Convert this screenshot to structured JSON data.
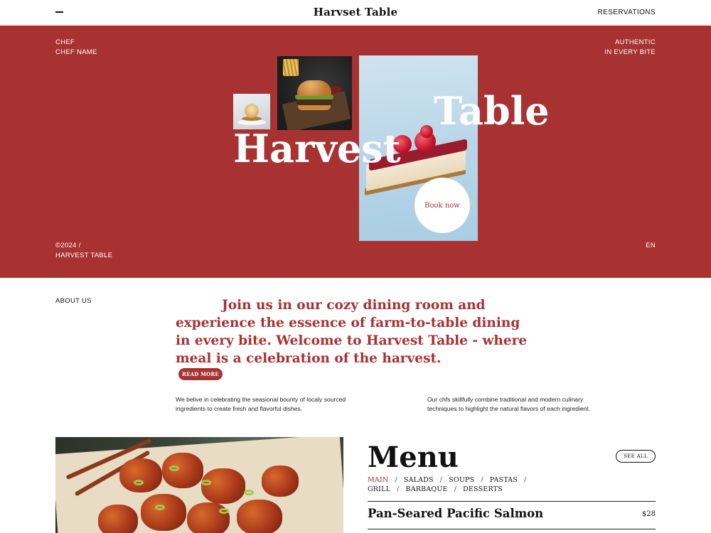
{
  "header": {
    "brand": "Harvset Table",
    "reservations": "RESERVATIONS"
  },
  "hero": {
    "chef_label": "CHEF",
    "chef_name": "CHEF NAME",
    "tagline_1": "AUTHENTIC",
    "tagline_2": "IN EVERY BITE",
    "copyright_1": "©2024 /",
    "copyright_2": "HARVEST TABLE",
    "language": "EN",
    "word_1": "Harvest",
    "word_2": "Table",
    "book_label": "Book now",
    "colors": {
      "accent": "#a83232"
    }
  },
  "about": {
    "label": "ABOUT US",
    "quote": "Join us in our cozy dining room and experience the essence of farm-to-table dining in every bite. Welcome to Harvest Table - where meal is a celebration of the harvest.",
    "read_more": "READ MORE",
    "para_1": "We belive in celebrating the seasional bounty of localy sourced ingredients to create fresh and flavorful dishes.",
    "para_2": "Our chfs skillfully combine traditional and modern culinary techniques to highlight the natural flavors of each ingredient."
  },
  "menu": {
    "title": "Menu",
    "see_all": "SEE ALL",
    "categories": [
      "MAIN",
      "SALADS",
      "SOUPS",
      "PASTAS",
      "GRILL",
      "BARBAQUE",
      "DESSERTS"
    ],
    "active_category": "MAIN",
    "items": [
      {
        "name": "Pan-Seared Pacific Salmon",
        "price": "$28"
      }
    ]
  }
}
